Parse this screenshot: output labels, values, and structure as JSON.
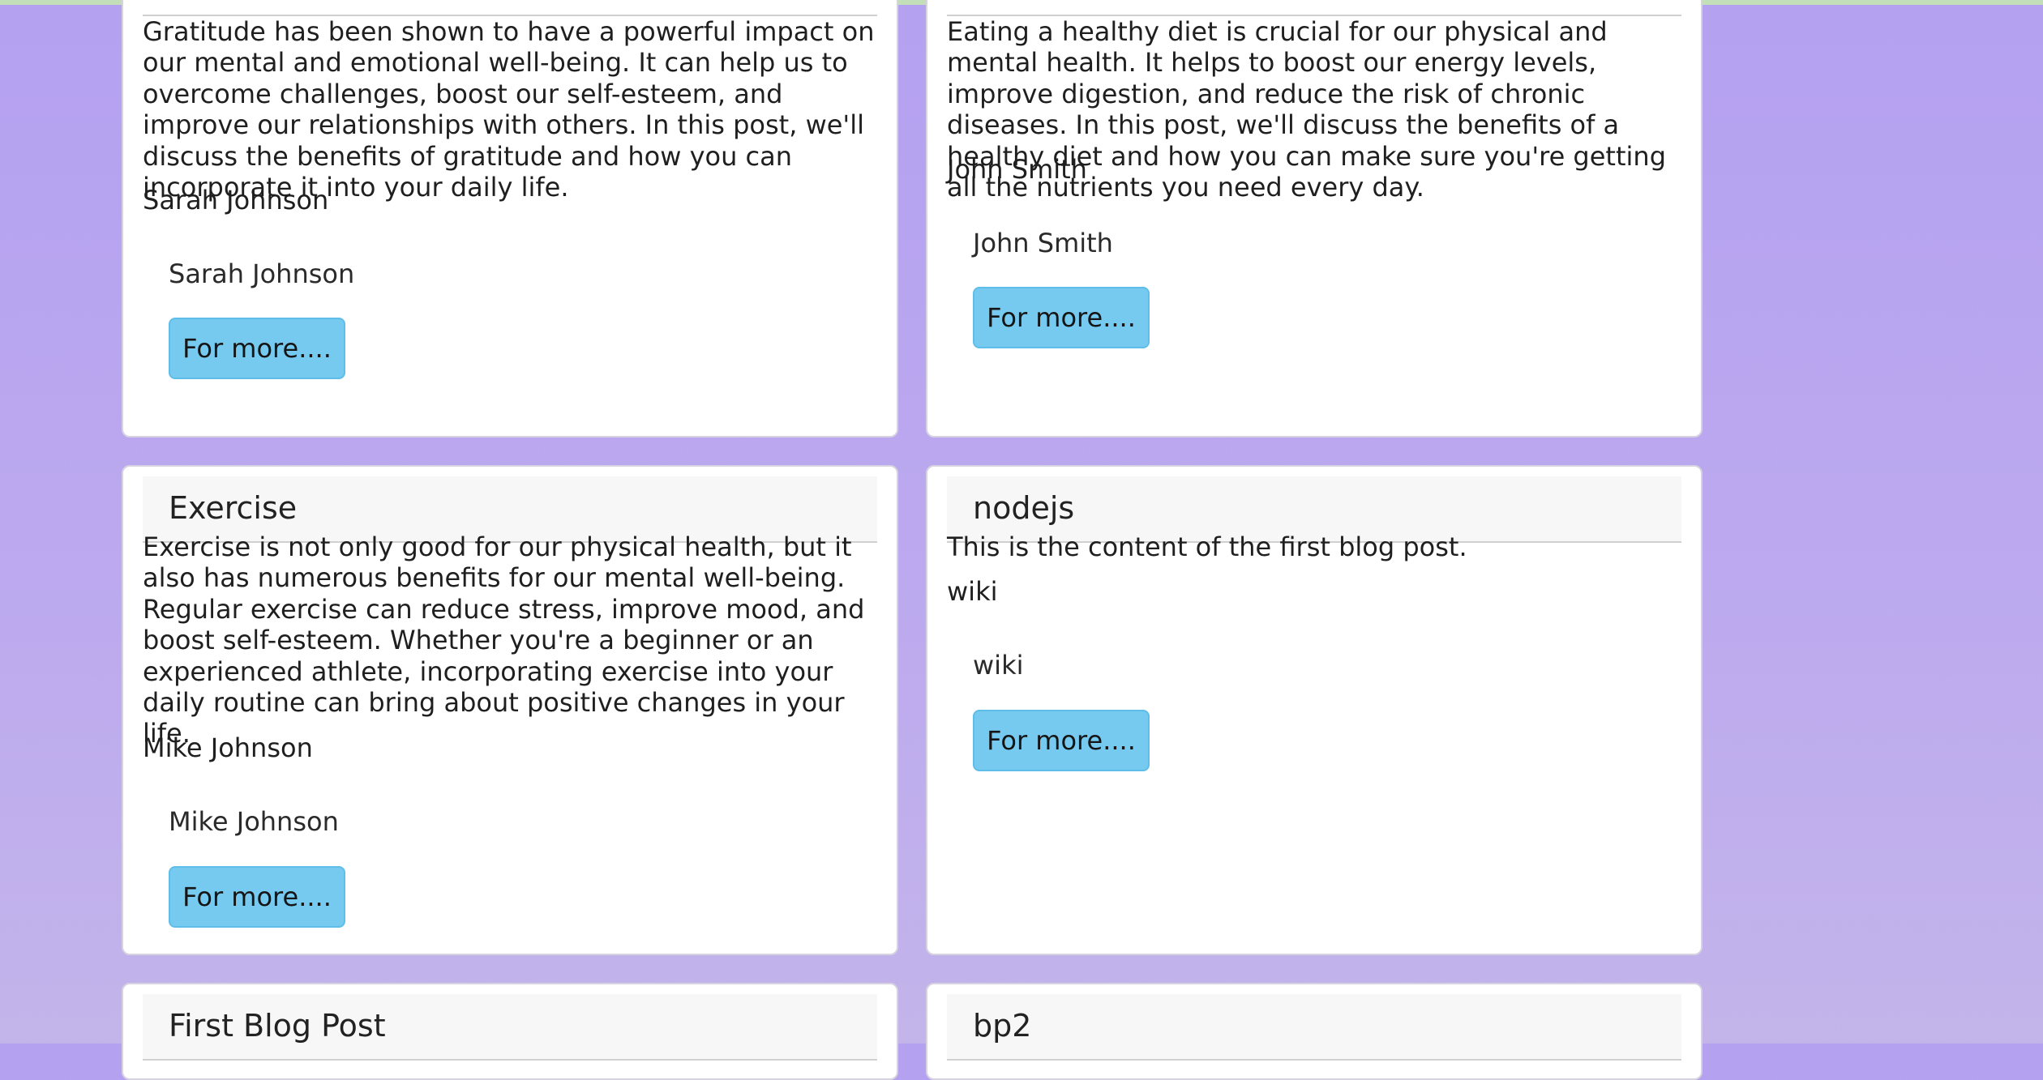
{
  "posts": [
    {
      "title": "",
      "content": "Gratitude has been shown to have a powerful impact on our mental and emotional well-being. It can help us to overcome challenges, boost our self-esteem, and improve our relationships with others. In this post, we'll discuss the benefits of gratitude and how you can incorporate it into your daily life.",
      "author": "Sarah Johnson",
      "signature": "Sarah Johnson",
      "button_label": "For more...."
    },
    {
      "title": "",
      "content": "Eating a healthy diet is crucial for our physical and mental health. It helps to boost our energy levels, improve digestion, and reduce the risk of chronic diseases. In this post, we'll discuss the benefits of a healthy diet and how you can make sure you're getting all the nutrients you need every day.",
      "author": "John Smith",
      "signature": "John Smith",
      "button_label": "For more...."
    },
    {
      "title": "Exercise",
      "content": "Exercise is not only good for our physical health, but it also has numerous benefits for our mental well-being. Regular exercise can reduce stress, improve mood, and boost self-esteem. Whether you're a beginner or an experienced athlete, incorporating exercise into your daily routine can bring about positive changes in your life.",
      "author": "Mike Johnson",
      "signature": "Mike Johnson",
      "button_label": "For more...."
    },
    {
      "title": "nodejs",
      "content": "This is the content of the first blog post.",
      "author": "wiki",
      "signature": "wiki",
      "button_label": "For more...."
    },
    {
      "title": "First Blog Post"
    },
    {
      "title": "bp2"
    }
  ]
}
